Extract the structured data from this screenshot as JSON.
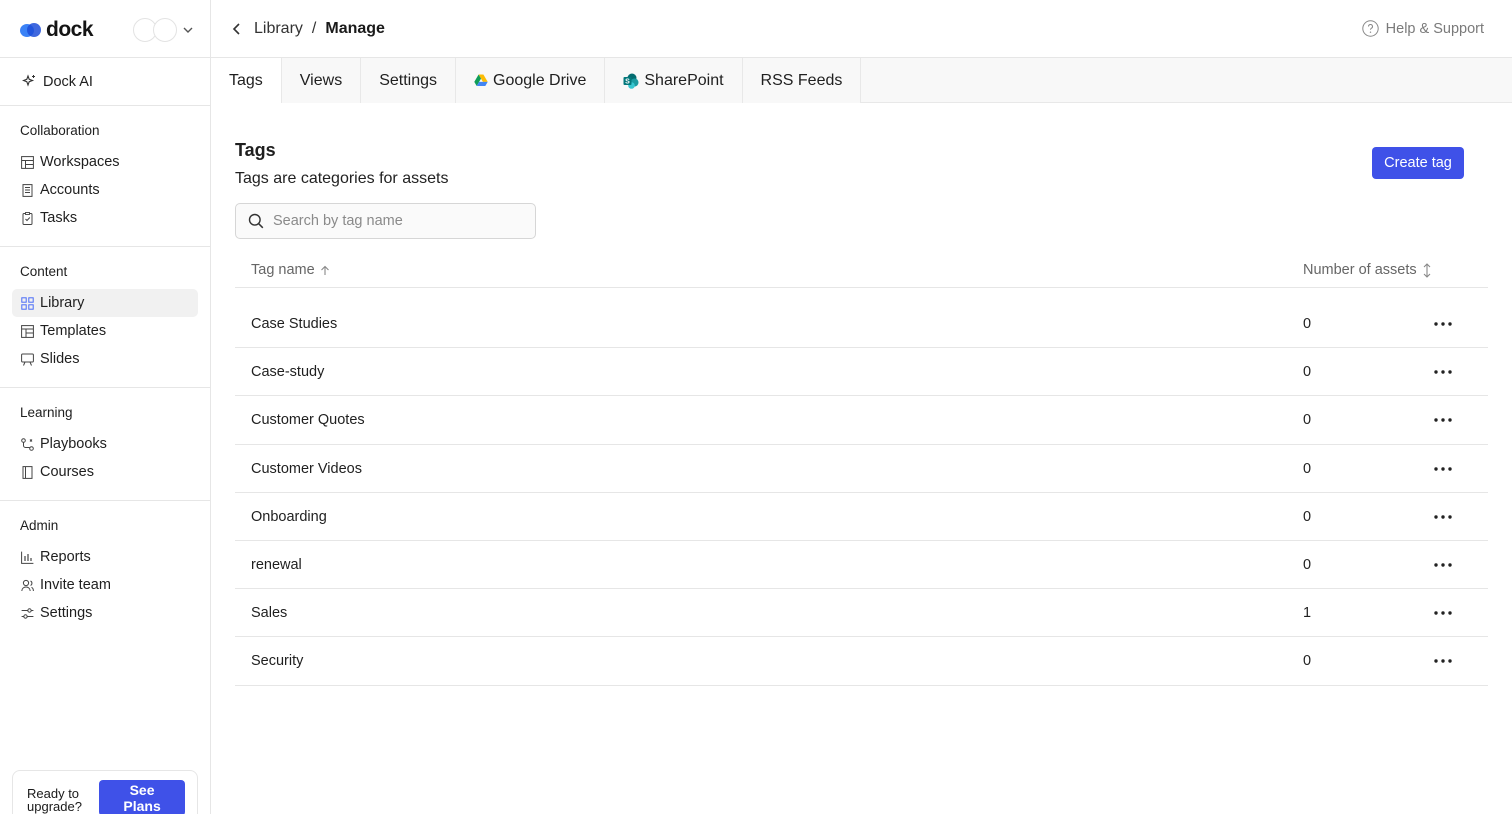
{
  "brand": {
    "name": "dock"
  },
  "sidebar": {
    "dock_ai": "Dock AI",
    "sections": [
      {
        "title": "Collaboration",
        "items": [
          {
            "label": "Workspaces",
            "icon": "workspaces-icon"
          },
          {
            "label": "Accounts",
            "icon": "accounts-icon"
          },
          {
            "label": "Tasks",
            "icon": "tasks-icon"
          }
        ]
      },
      {
        "title": "Content",
        "items": [
          {
            "label": "Library",
            "icon": "library-icon",
            "active": true
          },
          {
            "label": "Templates",
            "icon": "templates-icon"
          },
          {
            "label": "Slides",
            "icon": "slides-icon"
          }
        ]
      },
      {
        "title": "Learning",
        "items": [
          {
            "label": "Playbooks",
            "icon": "playbooks-icon"
          },
          {
            "label": "Courses",
            "icon": "courses-icon"
          }
        ]
      },
      {
        "title": "Admin",
        "items": [
          {
            "label": "Reports",
            "icon": "reports-icon"
          },
          {
            "label": "Invite team",
            "icon": "invite-team-icon"
          },
          {
            "label": "Settings",
            "icon": "settings-icon"
          }
        ]
      }
    ],
    "upgrade": {
      "text": "Ready to upgrade?",
      "button": "See Plans"
    }
  },
  "topbar": {
    "breadcrumb": {
      "parent": "Library",
      "separator": "/",
      "current": "Manage"
    },
    "help": "Help & Support"
  },
  "tabs": [
    {
      "label": "Tags",
      "active": true
    },
    {
      "label": "Views"
    },
    {
      "label": "Settings"
    },
    {
      "label": "Google Drive",
      "icon": "google-drive-icon"
    },
    {
      "label": "SharePoint",
      "icon": "sharepoint-icon"
    },
    {
      "label": "RSS Feeds"
    }
  ],
  "main": {
    "title": "Tags",
    "subtitle": "Tags are categories for assets",
    "create_button": "Create tag",
    "search_placeholder": "Search by tag name",
    "columns": {
      "name": "Tag name",
      "count": "Number of assets"
    },
    "rows": [
      {
        "name": "Case Studies",
        "count": "0"
      },
      {
        "name": "Case-study",
        "count": "0"
      },
      {
        "name": "Customer Quotes",
        "count": "0"
      },
      {
        "name": "Customer Videos",
        "count": "0"
      },
      {
        "name": "Onboarding",
        "count": "0"
      },
      {
        "name": "renewal",
        "count": "0"
      },
      {
        "name": "Sales",
        "count": "1"
      },
      {
        "name": "Security",
        "count": "0"
      }
    ]
  },
  "colors": {
    "accent": "#3f51e8",
    "border": "#e6e6e6",
    "muted": "#7a7a7a"
  }
}
